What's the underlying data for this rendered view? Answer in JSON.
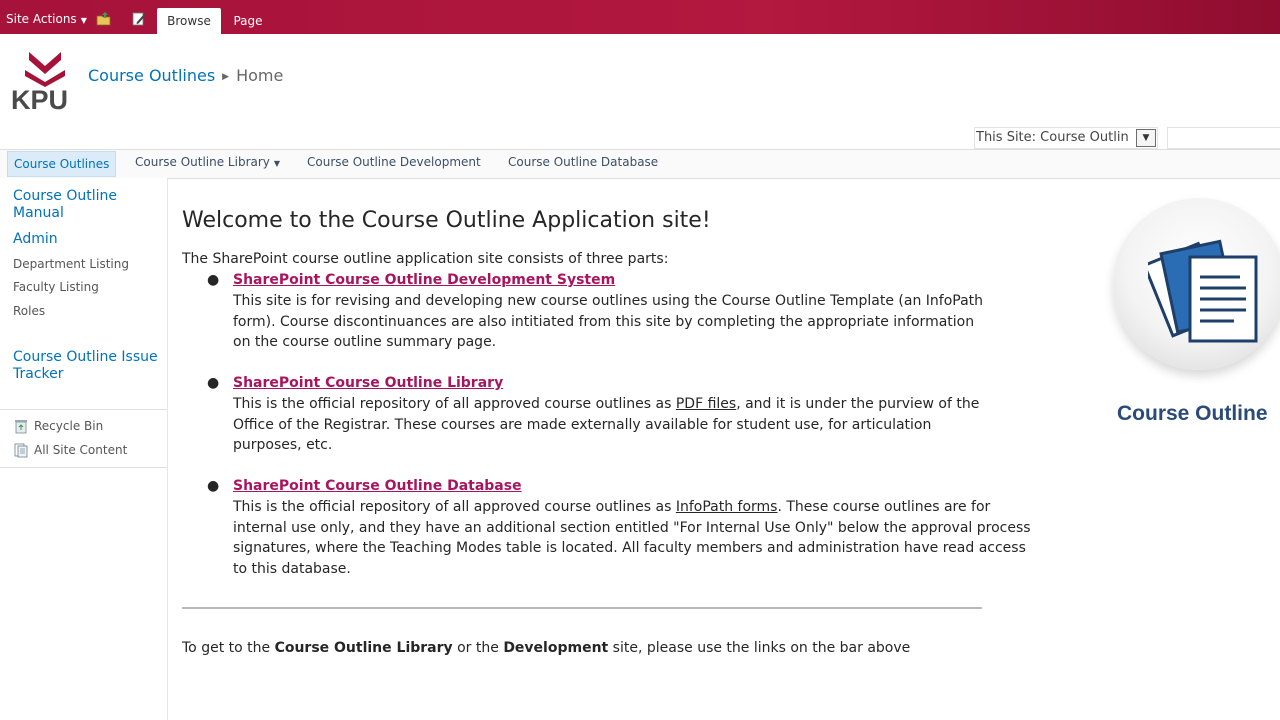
{
  "ribbon": {
    "site_actions": "Site Actions",
    "tabs": [
      {
        "label": "Browse",
        "active": true
      },
      {
        "label": "Page",
        "active": false
      }
    ],
    "colors": {
      "bar": "#a5123a"
    }
  },
  "logo": {
    "text": "KPU"
  },
  "breadcrumb": {
    "site": "Course Outlines",
    "page": "Home"
  },
  "search": {
    "scope": "This Site: Course Outlin"
  },
  "topnav": {
    "items": [
      {
        "label": "Course Outlines",
        "selected": true
      },
      {
        "label": "Course Outline Library",
        "dropdown": true
      },
      {
        "label": "Course Outline Development"
      },
      {
        "label": "Course Outline Database"
      }
    ]
  },
  "leftnav": {
    "manual": "Course Outline Manual",
    "admin": "Admin",
    "sub": [
      "Department Listing",
      "Faculty Listing",
      "Roles"
    ],
    "tracker": "Course Outline Issue Tracker",
    "recycle": "Recycle Bin",
    "all_content": "All Site Content"
  },
  "main": {
    "title": "Welcome to the Course Outline Application site!",
    "intro": "The SharePoint course outline application site consists of three parts:",
    "parts": [
      {
        "link": "SharePoint Course Outline Development System",
        "text": "This site is for revising and developing new course outlines using the Course Outline Template (an InfoPath form). Course discontinuances are also intitiated from   this site by completing the appropriate information on the course outline summary page."
      },
      {
        "link": "SharePoint Course Outline Library",
        "text_a": "This is the official repository of all approved course outlines as ",
        "text_u": "PDF files",
        "text_b": ", and it is under the purview of the Office of the Registrar. These courses are made externally available for student use, for articulation purposes, etc."
      },
      {
        "link": "SharePoint Course Outline Database",
        "text_a": "This is the official repository of all approved course outlines as ",
        "text_u": "InfoPath forms",
        "text_b": ". These course outlines are for internal use only, and they have an additional section entitled \"For Internal Use Only\" below the approval process signatures, where the Teaching Modes table is located. All faculty members and administration have read access to this database."
      }
    ],
    "footer": {
      "a": "To get to the ",
      "b": "Course Outline Library",
      "c": " or the ",
      "d": "Development",
      "e": " site, please use the links on the bar above"
    }
  },
  "side_image": {
    "label": "Course Outline"
  }
}
